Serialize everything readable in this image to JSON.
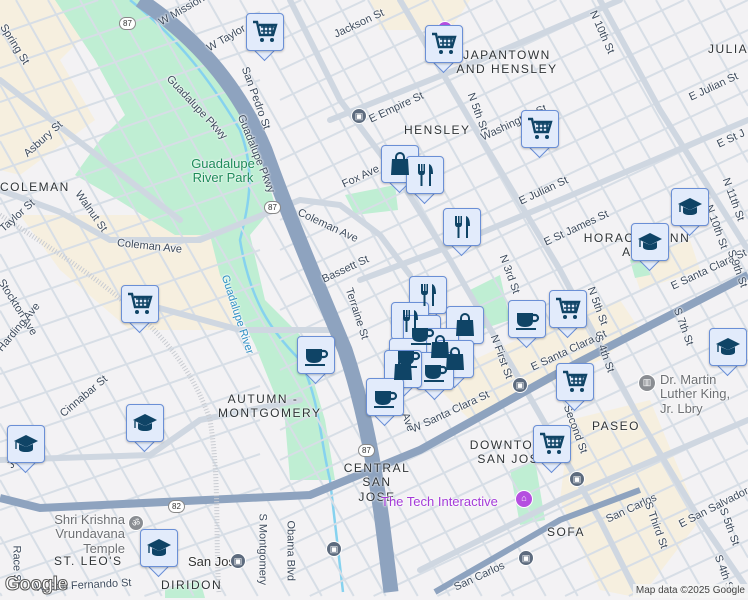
{
  "map": {
    "attribution": "Map data ©2025 Google",
    "logo": "Google",
    "colors": {
      "background": "#f3f2f4",
      "park": "#bfeed3",
      "highway": "#8ea3bf",
      "road": "#d3dbe4",
      "commercial": "#f6efdf",
      "marker_bg": "#e2ebfb",
      "marker_icon": "#0f4466"
    },
    "labels": {
      "streets": [
        "W Mission St",
        "Spring St",
        "W Taylor St",
        "San Pedro St",
        "Jackson St",
        "Guadalupe Pkwy",
        "Guadalupe Pkwy",
        "Asbury St",
        "Walnut St",
        "Fox Ave",
        "Coleman Ave",
        "Coleman Ave",
        "Taylor St",
        "Bassett St",
        "Terraine St",
        "Stockton Ave",
        "Harding Ave",
        "Cinnabar St",
        "Julian St",
        "S Montgomery",
        "Obama Blvd",
        "W San Fernando St",
        "Race St",
        "E Empire St",
        "N 5th St",
        "Washington St",
        "N 10th St",
        "E Julian St",
        "E Julian St",
        "E St J",
        "E St James St",
        "N 3rd St",
        "N 11th St",
        "N 10th St",
        "E Santa Clara St",
        "E Santa Clara St",
        "N 5th St",
        "S 9th St",
        "S 7th St",
        "N First St",
        "W Santa Clara St",
        "S 4th St",
        "Second St",
        "San Carlos",
        "E San Salvador",
        "S Third St",
        "S 5th St",
        "S 4th St",
        "San Carlos",
        "Ave"
      ],
      "neighborhoods": [
        "COLEMAN",
        "AUTUMN - MONTGOMERY",
        "CENTRAL SAN JOSE",
        "ST. LEO'S",
        "DIRIDON",
        "HENSLEY",
        "JAPANTOWN AND HENSLEY",
        "JULIA",
        "HORACE MANN AND",
        "PASEO",
        "DOWNTOWN SAN JOSE",
        "SOFA"
      ],
      "parks": [
        "Guadalupe River Park",
        "Guadalupe River"
      ],
      "pois": [
        "Shri Krishna Vrundavana Temple",
        "San Jose",
        "Dr. Martin Luther King, Jr. Lbry",
        "The Tech Interactive"
      ],
      "shields": [
        "87",
        "87",
        "87",
        "82"
      ]
    },
    "markers": [
      "cart",
      "cart",
      "cart",
      "shopping-bag",
      "restaurant",
      "restaurant",
      "restaurant",
      "cart",
      "cart",
      "coffee",
      "coffee",
      "shopping-bag",
      "restaurant",
      "coffee",
      "shopping-bag",
      "coffee",
      "shopping-bag",
      "coffee",
      "shopping-bag",
      "coffee",
      "cart",
      "cart",
      "school",
      "school",
      "school",
      "school",
      "school",
      "school"
    ]
  }
}
